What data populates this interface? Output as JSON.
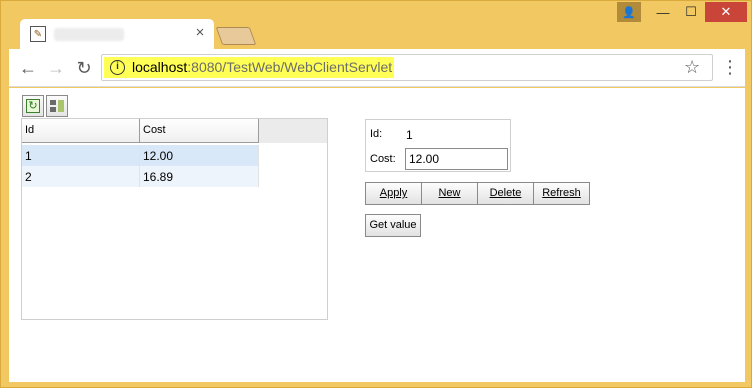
{
  "browser": {
    "tab": {
      "favicon": "applet-icon",
      "close_label": "×"
    },
    "window_controls": {
      "user": "👤",
      "minimize": "—",
      "maximize": "☐",
      "close": "✕"
    },
    "toolbar": {
      "back": "←",
      "forward": "→",
      "reload": "↻",
      "info": "i",
      "url_host": "localhost",
      "url_rest": ":8080/TestWeb/WebClientServlet",
      "star": "☆",
      "menu": "⋮"
    }
  },
  "app": {
    "tools": [
      {
        "name": "refresh-icon",
        "glyph": "↻"
      },
      {
        "name": "columns-icon"
      }
    ],
    "grid": {
      "columns": [
        "Id",
        "Cost"
      ],
      "rows": [
        {
          "id": "1",
          "cost": "12.00"
        },
        {
          "id": "2",
          "cost": "16.89"
        }
      ]
    },
    "detail": {
      "id_label": "Id:",
      "id_value": "1",
      "cost_label": "Cost:",
      "cost_value": "12.00"
    },
    "buttons": {
      "apply": "Apply",
      "new": "New",
      "delete": "Delete",
      "refresh": "Refresh",
      "get_value": "Get value"
    }
  },
  "colors": {
    "frame": "#f2c862",
    "selected_row": "#d9e8f8",
    "url_highlight": "#ffff55"
  }
}
